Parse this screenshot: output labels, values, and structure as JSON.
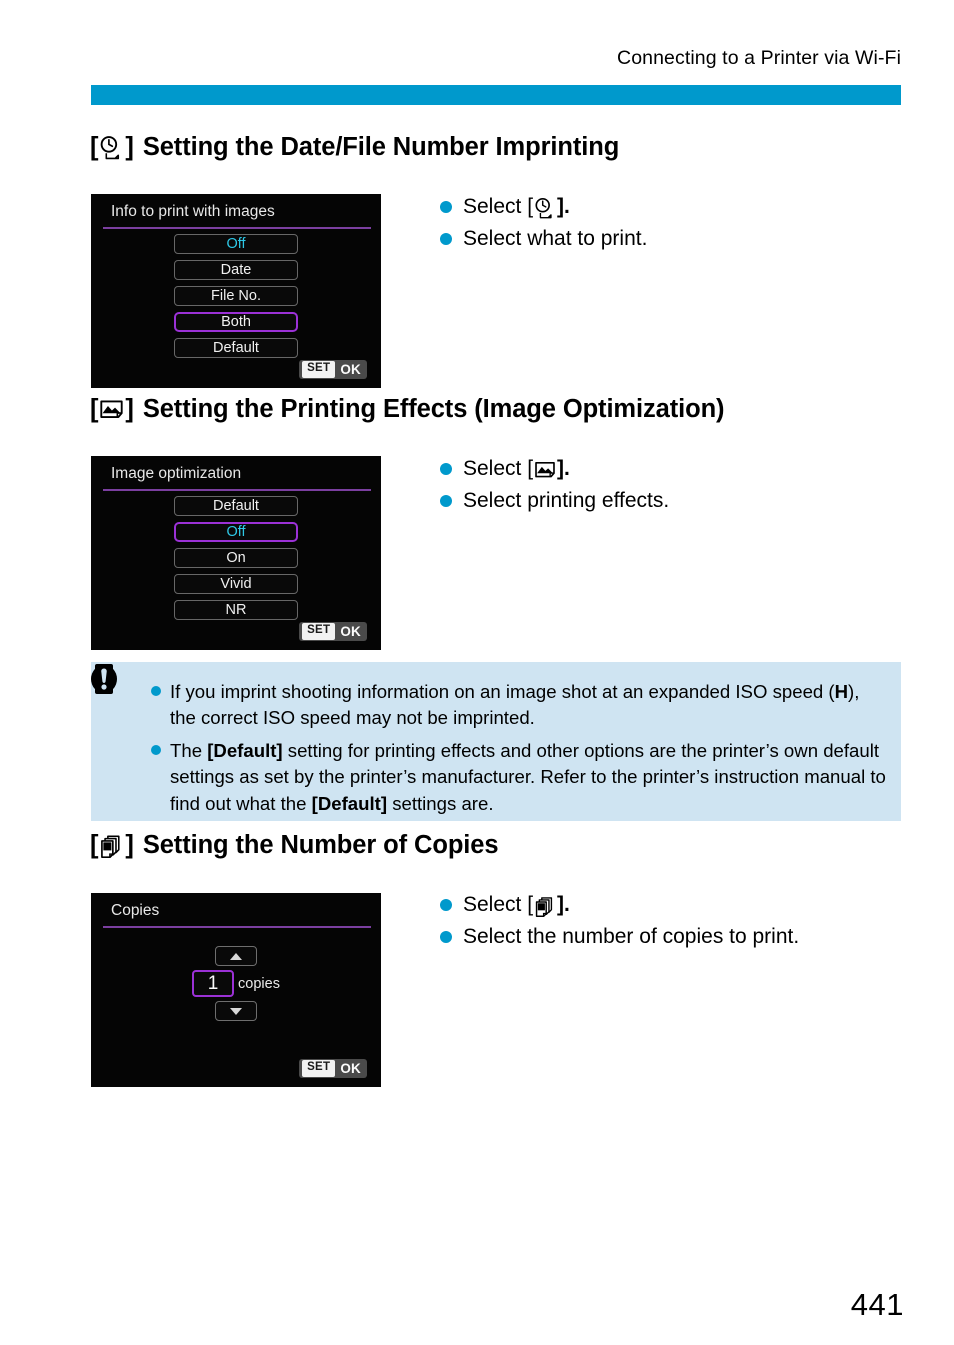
{
  "header": {
    "running_head": "Connecting to a Printer via Wi-Fi",
    "rule_color": "#0099cc"
  },
  "page": {
    "number": "441"
  },
  "sections": [
    {
      "id": "date-file-number-imprinting",
      "icon": "date-imprint-icon",
      "open_bracket": "[",
      "close_bracket": "]",
      "title": "Setting the Date/File Number Imprinting",
      "screen": {
        "name": "info-to-print-screen",
        "title": "Info to print with images",
        "options": [
          {
            "label": "Off",
            "style": "cyan",
            "selected": false
          },
          {
            "label": "Date",
            "style": "plain",
            "selected": false
          },
          {
            "label": "File No.",
            "style": "plain",
            "selected": false
          },
          {
            "label": "Both",
            "style": "plain",
            "selected": true
          },
          {
            "label": "Default",
            "style": "plain",
            "selected": false
          }
        ],
        "set_label": "SET",
        "ok_label": "OK"
      },
      "steps": [
        {
          "prefix": "Select [",
          "icon": "date-imprint-icon",
          "suffix": "]."
        },
        {
          "prefix": "Select what to print.",
          "icon": null,
          "suffix": ""
        }
      ]
    },
    {
      "id": "printing-effects",
      "icon": "image-optimization-icon",
      "open_bracket": "[",
      "close_bracket": "]",
      "title": "Setting the Printing Effects (Image Optimization)",
      "screen": {
        "name": "image-optimization-screen",
        "title": "Image optimization",
        "options": [
          {
            "label": "Default",
            "style": "plain",
            "selected": false
          },
          {
            "label": "Off",
            "style": "cyan",
            "selected": true
          },
          {
            "label": "On",
            "style": "plain",
            "selected": false
          },
          {
            "label": "Vivid",
            "style": "plain",
            "selected": false
          },
          {
            "label": "NR",
            "style": "plain",
            "selected": false
          }
        ],
        "set_label": "SET",
        "ok_label": "OK"
      },
      "steps": [
        {
          "prefix": "Select [",
          "icon": "image-optimization-icon",
          "suffix": "]."
        },
        {
          "prefix": "Select printing effects.",
          "icon": null,
          "suffix": ""
        }
      ]
    },
    {
      "id": "number-of-copies",
      "icon": "copies-icon",
      "open_bracket": "[",
      "close_bracket": "]",
      "title": "Setting the Number of Copies",
      "screen": {
        "name": "copies-screen",
        "title": "Copies",
        "count_value": "1",
        "count_unit": "copies",
        "set_label": "SET",
        "ok_label": "OK"
      },
      "steps": [
        {
          "prefix": "Select [",
          "icon": "copies-icon",
          "suffix": "]."
        },
        {
          "prefix": "Select the number of copies to print.",
          "icon": null,
          "suffix": ""
        }
      ]
    }
  ],
  "caution": {
    "icon": "caution-exclamation-icon",
    "background": "#cfe4f2",
    "items": [
      {
        "parts": [
          {
            "t": "If you imprint shooting information on an image shot at an expanded ISO speed (",
            "b": false
          },
          {
            "t": "H",
            "b": true
          },
          {
            "t": "), the correct ISO speed may not be imprinted.",
            "b": false
          }
        ]
      },
      {
        "parts": [
          {
            "t": "The ",
            "b": false
          },
          {
            "t": "[Default]",
            "b": true
          },
          {
            "t": " setting for printing effects and other options are the printer’s own default settings as set by the printer’s manufacturer. Refer to the printer’s instruction manual to find out what the ",
            "b": false
          },
          {
            "t": "[Default]",
            "b": true
          },
          {
            "t": " settings are.",
            "b": false
          }
        ]
      }
    ]
  }
}
